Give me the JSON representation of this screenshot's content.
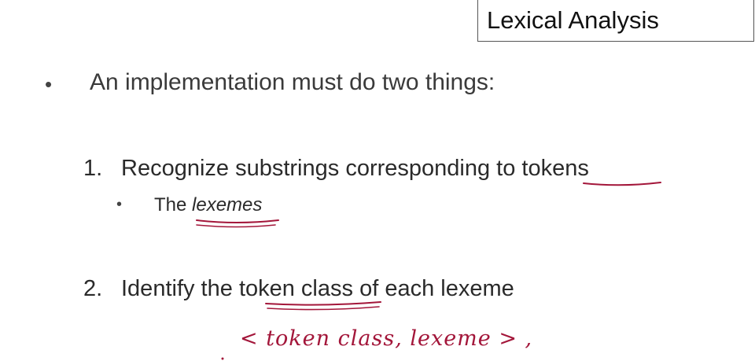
{
  "slide": {
    "title": "Lexical Analysis",
    "faded_header": "",
    "main_bullet": "An implementation must do two things:",
    "items": [
      {
        "number": "1.",
        "text_before": "Recognize substrings corresponding to ",
        "underlined": "tokens",
        "text_after": ""
      },
      {
        "number": "2.",
        "text_before": "Identify the ",
        "underlined": "token class",
        "text_after": " of each lexeme"
      }
    ],
    "sub_bullet": {
      "prefix": "The ",
      "emphasis": "lexemes"
    },
    "handwritten_note": "< token class, lexeme > ,"
  },
  "colors": {
    "text": "#2a2a2a",
    "annotation_ink": "#a3163a",
    "title_border": "#555555"
  }
}
